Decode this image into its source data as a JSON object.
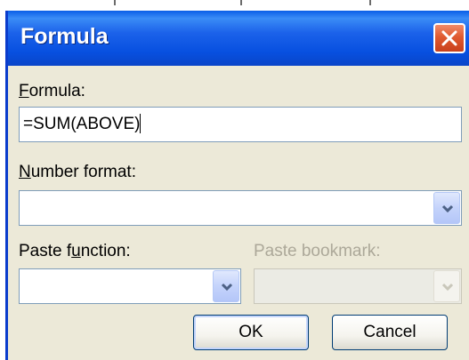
{
  "dialog": {
    "title": "Formula",
    "close_icon": "close-icon"
  },
  "formula": {
    "label_accel": "F",
    "label_rest": "ormula:",
    "value": "=SUM(ABOVE)"
  },
  "number_format": {
    "label_accel": "N",
    "label_rest": "umber format:",
    "value": ""
  },
  "paste_function": {
    "label_pre": "Paste f",
    "label_accel": "u",
    "label_rest": "nction:",
    "value": ""
  },
  "paste_bookmark": {
    "label": "Paste bookmark:",
    "value": "",
    "enabled": false
  },
  "buttons": {
    "ok": "OK",
    "cancel": "Cancel"
  },
  "colors": {
    "titlebar": "#0a5ee8",
    "dialog_bg": "#ece9d8",
    "close_button": "#e05a30"
  }
}
